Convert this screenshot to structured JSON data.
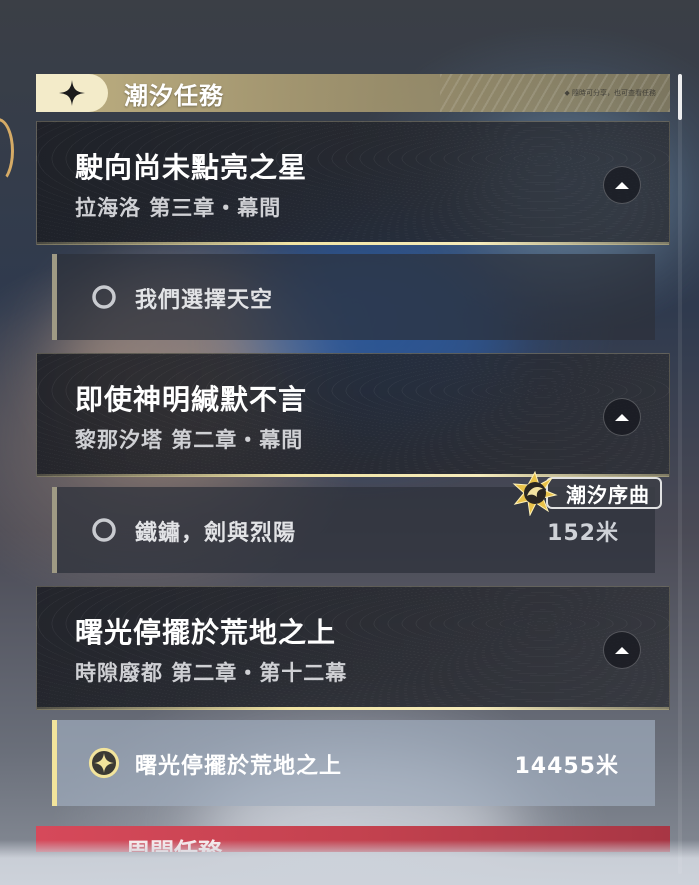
{
  "category": {
    "title": "潮汐任務",
    "badge_icon": "four-point-star-icon",
    "note": "◆ 隨時可分享，也可查看任務"
  },
  "quests": [
    {
      "title": "駛向尚未點亮之星",
      "subtitle": "拉海洛 第三章・幕間",
      "collapse_icon": "chevron-up-icon",
      "objective": {
        "label": "我們選擇天空",
        "distance": "",
        "icon": "circle-outline-icon",
        "tracked": false
      }
    },
    {
      "title": "即使神明緘默不言",
      "subtitle": "黎那汐塔 第二章・幕間",
      "collapse_icon": "chevron-up-icon",
      "objective": {
        "label": "鐵鏽，劍與烈陽",
        "distance": "152米",
        "icon": "circle-outline-icon",
        "tracked": false
      }
    },
    {
      "title": "曙光停擺於荒地之上",
      "subtitle": "時隙廢都 第二章・第十二幕",
      "collapse_icon": "chevron-up-icon",
      "objective": {
        "label": "曙光停擺於荒地之上",
        "distance": "14455米",
        "icon": "tracked-star-icon",
        "tracked": true
      }
    }
  ],
  "floating_tag": {
    "label": "潮汐序曲",
    "icon": "tide-prelude-emblem-icon"
  },
  "next_category": {
    "title": "周開任務"
  },
  "colors": {
    "accent_gold": "#f1e4a4",
    "card_bg": "#1e2026",
    "next_category_red": "#d6495a"
  }
}
